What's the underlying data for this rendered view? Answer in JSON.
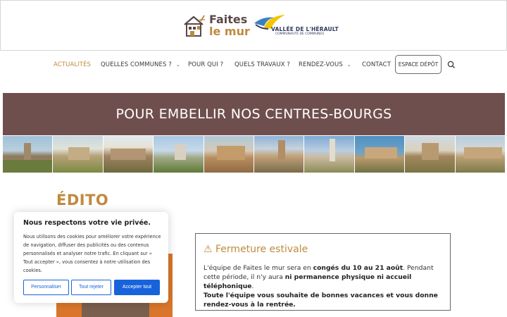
{
  "header": {
    "logo_faites": {
      "line1": "Faites",
      "line2": "le mur"
    },
    "logo_vallee": {
      "name": "VALLÉE DE L'HÉRAULT",
      "sub": "COMMUNAUTÉ DE COMMUNES"
    }
  },
  "nav": {
    "items": [
      {
        "label": "ACTUALITÉS",
        "active": true
      },
      {
        "label": "QUELLES COMMUNES ?",
        "dropdown": true
      },
      {
        "label": "POUR QUI ?"
      },
      {
        "label": "QUELS TRAVAUX ?"
      },
      {
        "label": "RENDEZ-VOUS",
        "dropdown": true
      },
      {
        "label": "CONTACT"
      }
    ],
    "depot_label": "ESPACE DÉPÔT",
    "search_icon": "search-icon"
  },
  "banner": {
    "title": "POUR EMBELLIR NOS CENTRES-BOURGS",
    "color": "#6f4f4d"
  },
  "edito": {
    "title": "ÉDITO"
  },
  "notice": {
    "icon": "⚠",
    "title": "Fermeture estivale",
    "p1_a": "L'équipe de Faites le mur sera en ",
    "p1_b": "congés du 10 au 21 août",
    "p1_c": ". Pendant cette période, il n'y aura ",
    "p1_d": "ni permanence physique ni accueil téléphonique",
    "p1_e": ".",
    "p2": "Toute l'équipe vous souhaite de bonnes vacances et vous donne rendez-vous à la rentrée."
  },
  "cookie": {
    "title": "Nous respectons votre vie privée.",
    "text": "Nous utilisons des cookies pour améliorer votre expérience de navigation, diffuser des publicités ou des contenus personnalisés et analyser notre trafic. En cliquant sur « Tout accepter », vous consentez à notre utilisation des cookies.",
    "btn_customize": "Personnaliser",
    "btn_reject": "Tout rejeter",
    "btn_accept": "Accepter tout"
  },
  "colors": {
    "accent": "#c08a3e",
    "brand_brown": "#6f4f4d",
    "cookie_blue": "#1863dc"
  }
}
